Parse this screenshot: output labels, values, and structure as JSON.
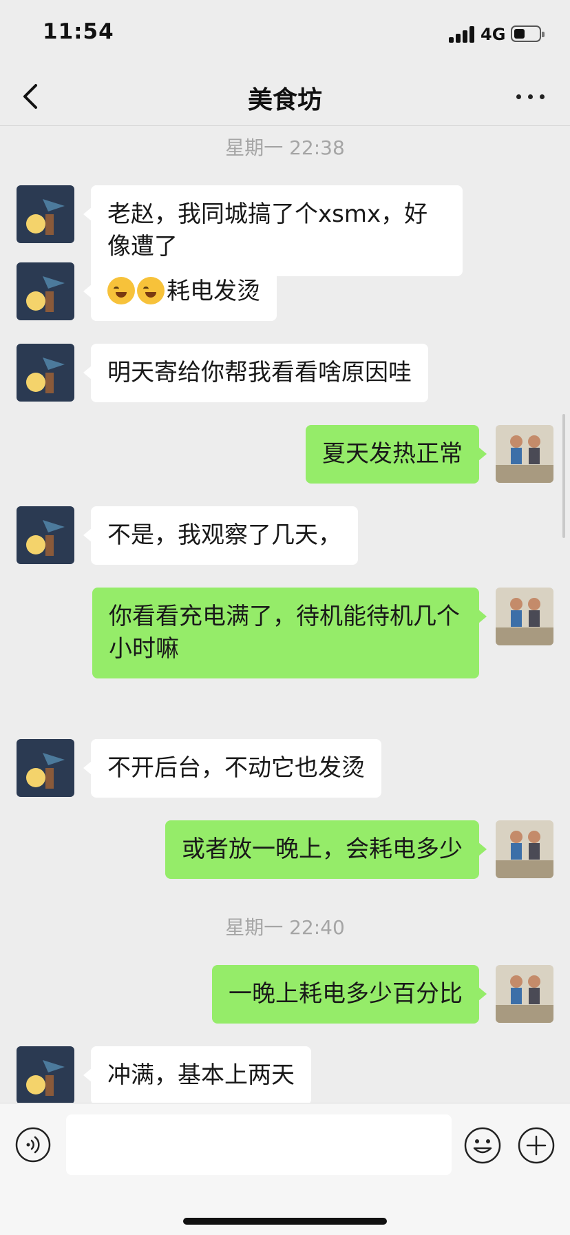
{
  "status_bar": {
    "time": "11:54",
    "network": "4G",
    "battery_fraction": 0.45
  },
  "nav": {
    "title": "美食坊",
    "back_icon": "chevron-left-icon",
    "more_icon": "more-dots-icon"
  },
  "timestamps": [
    "星期一 22:38",
    "星期一 22:40"
  ],
  "messages": [
    {
      "side": "in",
      "text": "老赵，我同城搞了个xsmx，好像遭了"
    },
    {
      "side": "in",
      "prefix_emoji": "crying-laughing-emoji",
      "text": "耗电发烫"
    },
    {
      "side": "in",
      "text": "明天寄给你帮我看看啥原因哇"
    },
    {
      "side": "out",
      "text": "夏天发热正常"
    },
    {
      "side": "in",
      "text": "不是，我观察了几天，"
    },
    {
      "side": "out",
      "text": "你看看充电满了，待机能待机几个小时嘛"
    },
    {
      "side": "in",
      "text": "不开后台，不动它也发烫"
    },
    {
      "side": "out",
      "text": "或者放一晚上，会耗电多少"
    },
    {
      "side": "out",
      "text": "一晚上耗电多少百分比"
    },
    {
      "side": "in",
      "text": "冲满，基本上两天"
    }
  ],
  "input_bar": {
    "voice_icon": "voice-icon",
    "text_value": "",
    "emoji_icon": "emoji-smile-icon",
    "plus_icon": "plus-circle-icon"
  },
  "colors": {
    "background": "#ededed",
    "incoming_bubble": "#ffffff",
    "outgoing_bubble": "#95ec69",
    "timestamp": "#a5a5a5"
  }
}
